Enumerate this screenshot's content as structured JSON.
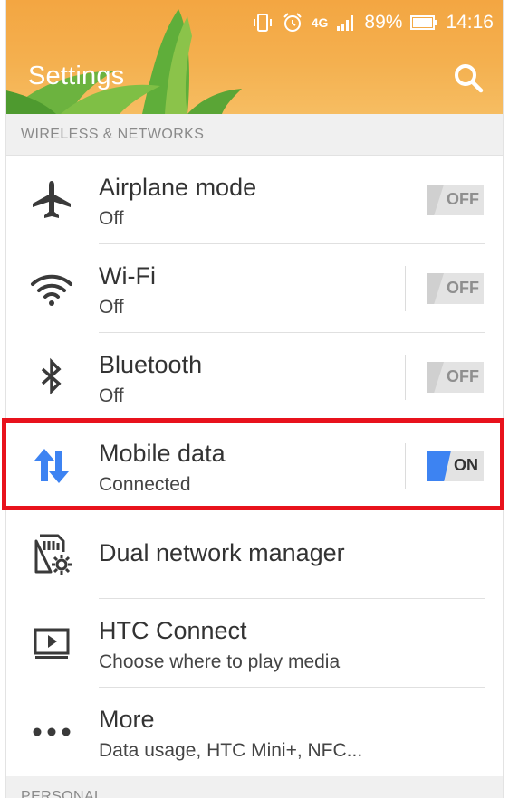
{
  "status_bar": {
    "network": "4G",
    "battery_percent": "89%",
    "time": "14:16"
  },
  "header": {
    "title": "Settings"
  },
  "sections": {
    "wireless": "WIRELESS & NETWORKS",
    "personal": "PERSONAL"
  },
  "items": [
    {
      "label": "Airplane mode",
      "subtitle": "Off",
      "icon": "airplane-icon",
      "toggle": "OFF"
    },
    {
      "label": "Wi-Fi",
      "subtitle": "Off",
      "icon": "wifi-icon",
      "toggle": "OFF"
    },
    {
      "label": "Bluetooth",
      "subtitle": "Off",
      "icon": "bluetooth-icon",
      "toggle": "OFF"
    },
    {
      "label": "Mobile data",
      "subtitle": "Connected",
      "icon": "mobile-data-icon",
      "toggle": "ON"
    },
    {
      "label": "Dual network manager",
      "icon": "sim-settings-icon"
    },
    {
      "label": "HTC Connect",
      "subtitle": "Choose where to play media",
      "icon": "media-screen-icon"
    },
    {
      "label": "More",
      "subtitle": "Data usage, HTC Mini+, NFC...",
      "icon": "more-dots-icon"
    }
  ],
  "colors": {
    "header": "#f4b04f",
    "toggle_on": "#3d83f2",
    "highlight": "#e8121c"
  }
}
